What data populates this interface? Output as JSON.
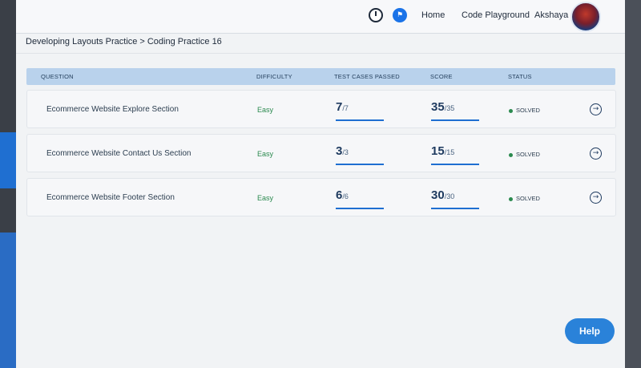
{
  "topbar": {
    "timer_icon": "timer-icon",
    "flag_icon": "flag-icon",
    "home_label": "Home",
    "playground_label": "Code Playground",
    "user_name": "Akshaya"
  },
  "breadcrumb": {
    "parent": "Developing Layouts Practice",
    "separator": ">",
    "current": "Coding Practice 16"
  },
  "table": {
    "headers": {
      "question": "QUESTION",
      "difficulty": "DIFFICULTY",
      "test_cases": "TEST CASES PASSED",
      "score": "SCORE",
      "status": "STATUS"
    },
    "rows": [
      {
        "question": "Ecommerce Website Explore Section",
        "difficulty": "Easy",
        "tests_passed": "7",
        "tests_total": "/7",
        "score": "35",
        "score_total": "/35",
        "status": "SOLVED"
      },
      {
        "question": "Ecommerce Website Contact Us Section",
        "difficulty": "Easy",
        "tests_passed": "3",
        "tests_total": "/3",
        "score": "15",
        "score_total": "/15",
        "status": "SOLVED"
      },
      {
        "question": "Ecommerce Website Footer Section",
        "difficulty": "Easy",
        "tests_passed": "6",
        "tests_total": "/6",
        "score": "30",
        "score_total": "/30",
        "status": "SOLVED"
      }
    ]
  },
  "help_label": "Help",
  "colors": {
    "accent": "#1f6fd1",
    "easy": "#2b8a4f",
    "header_bg": "#b9d2ec"
  }
}
